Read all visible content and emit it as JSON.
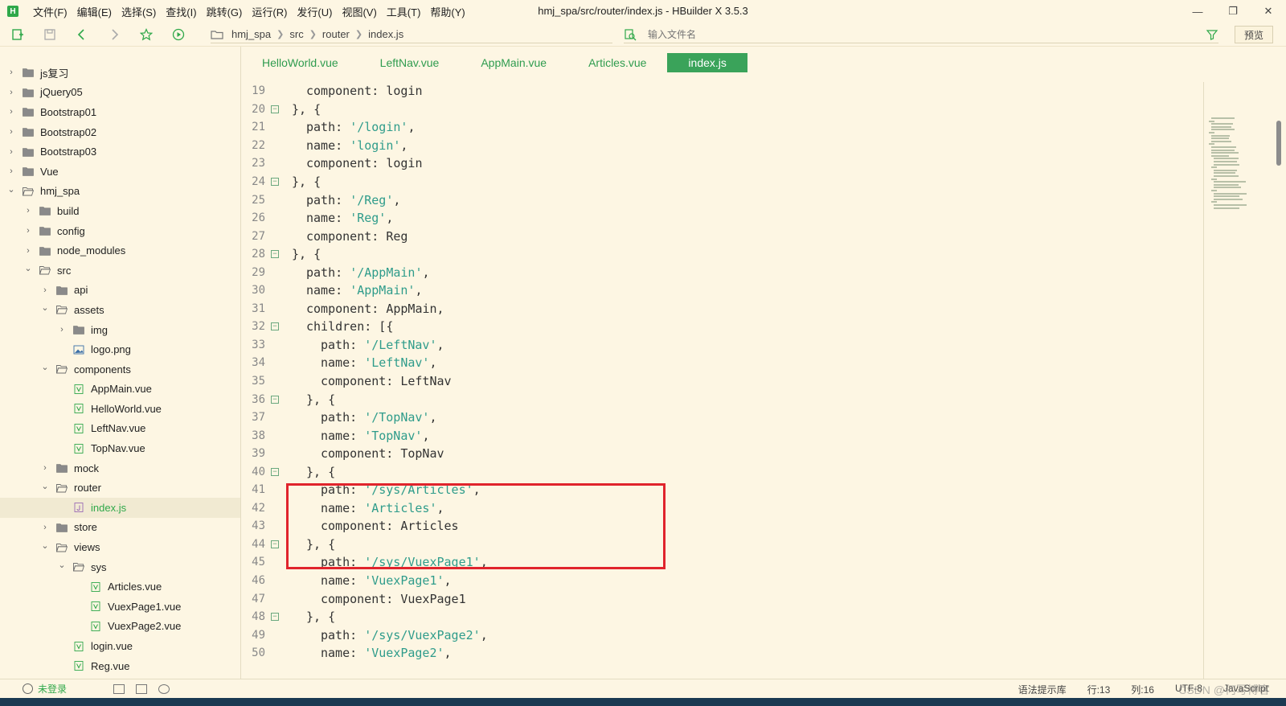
{
  "window": {
    "title": "hmj_spa/src/router/index.js - HBuilder X 3.5.3",
    "logo_letter": "H"
  },
  "menu": [
    "文件(F)",
    "编辑(E)",
    "选择(S)",
    "查找(I)",
    "跳转(G)",
    "运行(R)",
    "发行(U)",
    "视图(V)",
    "工具(T)",
    "帮助(Y)"
  ],
  "breadcrumb": [
    "hmj_spa",
    "src",
    "router",
    "index.js"
  ],
  "file_search": {
    "placeholder": "输入文件名"
  },
  "preview_label": "预览",
  "tree": [
    {
      "label": "js复习",
      "type": "folder",
      "depth": 0,
      "expanded": false
    },
    {
      "label": "jQuery05",
      "type": "folder",
      "depth": 0,
      "expanded": false
    },
    {
      "label": "Bootstrap01",
      "type": "folder",
      "depth": 0,
      "expanded": false
    },
    {
      "label": "Bootstrap02",
      "type": "folder",
      "depth": 0,
      "expanded": false
    },
    {
      "label": "Bootstrap03",
      "type": "folder",
      "depth": 0,
      "expanded": false
    },
    {
      "label": "Vue",
      "type": "folder",
      "depth": 0,
      "expanded": false
    },
    {
      "label": "hmj_spa",
      "type": "folder",
      "depth": 0,
      "expanded": true
    },
    {
      "label": "build",
      "type": "folder",
      "depth": 1,
      "expanded": false
    },
    {
      "label": "config",
      "type": "folder",
      "depth": 1,
      "expanded": false
    },
    {
      "label": "node_modules",
      "type": "folder",
      "depth": 1,
      "expanded": false
    },
    {
      "label": "src",
      "type": "folder",
      "depth": 1,
      "expanded": true
    },
    {
      "label": "api",
      "type": "folder",
      "depth": 2,
      "expanded": false
    },
    {
      "label": "assets",
      "type": "folder",
      "depth": 2,
      "expanded": true
    },
    {
      "label": "img",
      "type": "folder",
      "depth": 3,
      "expanded": false
    },
    {
      "label": "logo.png",
      "type": "image",
      "depth": 3
    },
    {
      "label": "components",
      "type": "folder",
      "depth": 2,
      "expanded": true
    },
    {
      "label": "AppMain.vue",
      "type": "vue",
      "depth": 3
    },
    {
      "label": "HelloWorld.vue",
      "type": "vue",
      "depth": 3
    },
    {
      "label": "LeftNav.vue",
      "type": "vue",
      "depth": 3
    },
    {
      "label": "TopNav.vue",
      "type": "vue",
      "depth": 3
    },
    {
      "label": "mock",
      "type": "folder",
      "depth": 2,
      "expanded": false
    },
    {
      "label": "router",
      "type": "folder",
      "depth": 2,
      "expanded": true
    },
    {
      "label": "index.js",
      "type": "js",
      "depth": 3,
      "selected": true
    },
    {
      "label": "store",
      "type": "folder",
      "depth": 2,
      "expanded": false
    },
    {
      "label": "views",
      "type": "folder",
      "depth": 2,
      "expanded": true
    },
    {
      "label": "sys",
      "type": "folder",
      "depth": 3,
      "expanded": true
    },
    {
      "label": "Articles.vue",
      "type": "vue",
      "depth": 4
    },
    {
      "label": "VuexPage1.vue",
      "type": "vue",
      "depth": 4
    },
    {
      "label": "VuexPage2.vue",
      "type": "vue",
      "depth": 4
    },
    {
      "label": "login.vue",
      "type": "vue",
      "depth": 3
    },
    {
      "label": "Reg.vue",
      "type": "vue",
      "depth": 3
    }
  ],
  "tabs": [
    {
      "label": "HelloWorld.vue",
      "active": false
    },
    {
      "label": "LeftNav.vue",
      "active": false
    },
    {
      "label": "AppMain.vue",
      "active": false
    },
    {
      "label": "Articles.vue",
      "active": false
    },
    {
      "label": "index.js",
      "active": true
    }
  ],
  "code": [
    {
      "n": "19",
      "fold": false,
      "indent": 1,
      "text": "component: login"
    },
    {
      "n": "20",
      "fold": true,
      "indent": 0,
      "text": "}, {"
    },
    {
      "n": "21",
      "fold": false,
      "indent": 1,
      "text": "path: '/login',"
    },
    {
      "n": "22",
      "fold": false,
      "indent": 1,
      "text": "name: 'login',"
    },
    {
      "n": "23",
      "fold": false,
      "indent": 1,
      "text": "component: login"
    },
    {
      "n": "24",
      "fold": true,
      "indent": 0,
      "text": "}, {"
    },
    {
      "n": "25",
      "fold": false,
      "indent": 1,
      "text": "path: '/Reg',"
    },
    {
      "n": "26",
      "fold": false,
      "indent": 1,
      "text": "name: 'Reg',"
    },
    {
      "n": "27",
      "fold": false,
      "indent": 1,
      "text": "component: Reg"
    },
    {
      "n": "28",
      "fold": true,
      "indent": 0,
      "text": "}, {"
    },
    {
      "n": "29",
      "fold": false,
      "indent": 1,
      "text": "path: '/AppMain',"
    },
    {
      "n": "30",
      "fold": false,
      "indent": 1,
      "text": "name: 'AppMain',"
    },
    {
      "n": "31",
      "fold": false,
      "indent": 1,
      "text": "component: AppMain,"
    },
    {
      "n": "32",
      "fold": true,
      "indent": 1,
      "text": "children: [{"
    },
    {
      "n": "33",
      "fold": false,
      "indent": 2,
      "text": "path: '/LeftNav',"
    },
    {
      "n": "34",
      "fold": false,
      "indent": 2,
      "text": "name: 'LeftNav',"
    },
    {
      "n": "35",
      "fold": false,
      "indent": 2,
      "text": "component: LeftNav"
    },
    {
      "n": "36",
      "fold": true,
      "indent": 1,
      "text": "}, {"
    },
    {
      "n": "37",
      "fold": false,
      "indent": 2,
      "text": "path: '/TopNav',"
    },
    {
      "n": "38",
      "fold": false,
      "indent": 2,
      "text": "name: 'TopNav',"
    },
    {
      "n": "39",
      "fold": false,
      "indent": 2,
      "text": "component: TopNav"
    },
    {
      "n": "40",
      "fold": true,
      "indent": 1,
      "text": "}, {"
    },
    {
      "n": "41",
      "fold": false,
      "indent": 2,
      "text": "path: '/sys/Articles',"
    },
    {
      "n": "42",
      "fold": false,
      "indent": 2,
      "text": "name: 'Articles',"
    },
    {
      "n": "43",
      "fold": false,
      "indent": 2,
      "text": "component: Articles"
    },
    {
      "n": "44",
      "fold": true,
      "indent": 1,
      "text": "}, {"
    },
    {
      "n": "45",
      "fold": false,
      "indent": 2,
      "text": "path: '/sys/VuexPage1',"
    },
    {
      "n": "46",
      "fold": false,
      "indent": 2,
      "text": "name: 'VuexPage1',"
    },
    {
      "n": "47",
      "fold": false,
      "indent": 2,
      "text": "component: VuexPage1"
    },
    {
      "n": "48",
      "fold": true,
      "indent": 1,
      "text": "}, {"
    },
    {
      "n": "49",
      "fold": false,
      "indent": 2,
      "text": "path: '/sys/VuexPage2',"
    },
    {
      "n": "50",
      "fold": false,
      "indent": 2,
      "text": "name: 'VuexPage2',"
    }
  ],
  "status": {
    "user": "未登录",
    "syntax": "语法提示库",
    "row": "行:13",
    "col": "列:16",
    "encoding": "UTF-8",
    "lang": "JavaScript"
  },
  "watermark": "CSDN @何写博客",
  "colors": {
    "accent": "#3aa35a",
    "background": "#fdf6e3",
    "string": "#2f9c8b",
    "highlight": "#e0242c"
  }
}
